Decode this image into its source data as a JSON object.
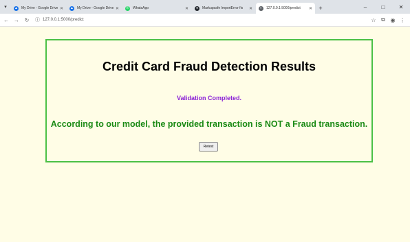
{
  "tabs": [
    {
      "title": "My Drive - Google Drive",
      "color": "#1a73e8",
      "active": false
    },
    {
      "title": "My Drive - Google Drive",
      "color": "#1a73e8",
      "active": false
    },
    {
      "title": "WhatsApp",
      "color": "#25d366",
      "active": false
    },
    {
      "title": "Markupsafe ImportError fix",
      "color": "#24292f",
      "active": false
    },
    {
      "title": "127.0.0.1:5000/predict",
      "color": "#5f6368",
      "active": true
    }
  ],
  "address": {
    "url": "127.0.0.1:5000/predict"
  },
  "page": {
    "title": "Credit Card Fraud Detection Results",
    "status": "Validation Completed.",
    "result": "According to our model, the provided transaction is NOT a Fraud transaction.",
    "retest_label": "Retest"
  },
  "colors": {
    "page_background": "#fffde6",
    "panel_border": "#4bc045",
    "status_text": "#8a1fd6",
    "result_text": "#1a8a15"
  },
  "icons": {
    "tab_search": "chevron-down-icon",
    "back": "back-arrow-icon",
    "forward": "forward-arrow-icon",
    "reload": "reload-icon",
    "site_info": "info-icon",
    "bookmark": "star-icon",
    "extensions": "puzzle-icon",
    "profile": "profile-icon",
    "menu": "kebab-menu-icon"
  }
}
